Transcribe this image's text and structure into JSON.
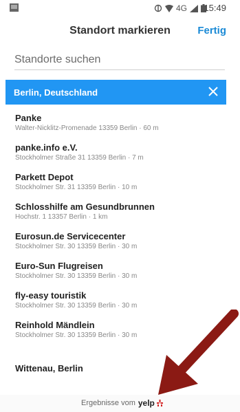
{
  "status_bar": {
    "network": "4G",
    "time": "15:49"
  },
  "header": {
    "title": "Standort markieren",
    "done_label": "Fertig"
  },
  "search": {
    "placeholder": "Standorte suchen"
  },
  "location_filter": {
    "label": "Berlin, Deutschland",
    "color": "#2196f3"
  },
  "results": [
    {
      "name": "Panke",
      "address": "Walter-Nicklitz-Promenade 13359 Berlin · 60 m"
    },
    {
      "name": "panke.info e.V.",
      "address": "Stockholmer Straße 31 13359 Berlin · 7 m"
    },
    {
      "name": "Parkett Depot",
      "address": "Stockholmer Str. 31 13359 Berlin · 10 m"
    },
    {
      "name": "Schlosshilfe am Gesundbrunnen",
      "address": "Hochstr. 1 13357 Berlin · 1 km"
    },
    {
      "name": "Eurosun.de Servicecenter",
      "address": "Stockholmer Str. 30 13359 Berlin · 30 m"
    },
    {
      "name": "Euro-Sun Flugreisen",
      "address": "Stockholmer Str. 30 13359 Berlin · 30 m"
    },
    {
      "name": "fly-easy touristik",
      "address": "Stockholmer Str. 30 13359 Berlin · 30 m"
    },
    {
      "name": "Reinhold Mändlein",
      "address": "Stockholmer Str. 30 13359 Berlin · 30 m"
    }
  ],
  "last_result": {
    "name": "Wittenau, Berlin"
  },
  "footer": {
    "text": "Ergebnisse vom",
    "brand": "yelp"
  },
  "colors": {
    "accent": "#1a8ad6",
    "arrow": "#8b1a14"
  }
}
